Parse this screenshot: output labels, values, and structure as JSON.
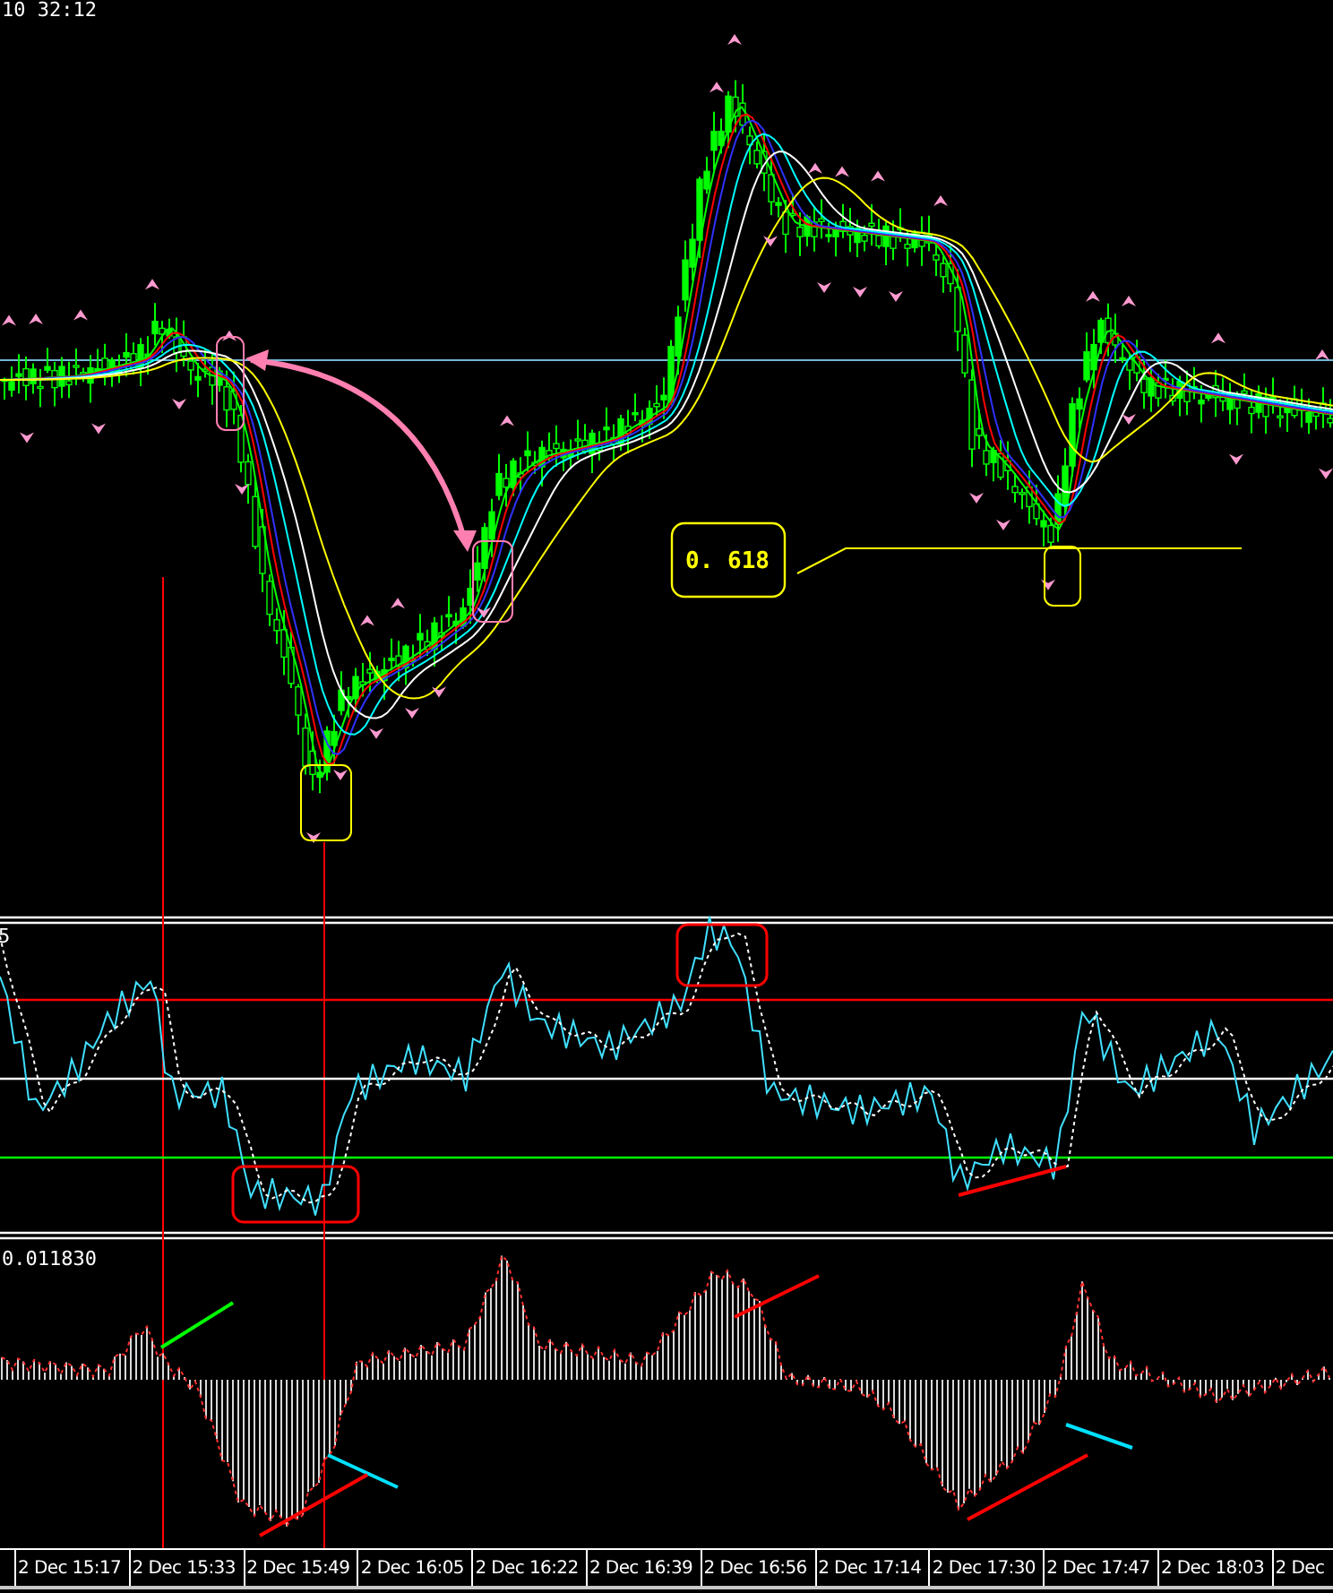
{
  "main_pane": {
    "time_label": "10 32:12",
    "ratio_label": "0. 618"
  },
  "oscillator_pane": {
    "label": "5"
  },
  "histogram_pane": {
    "label": "0.011830"
  },
  "time_axis": {
    "labels": [
      "2 Dec 15:17",
      "2 Dec 15:33",
      "2 Dec 15:49",
      "2 Dec 16:05",
      "2 Dec 16:22",
      "2 Dec 16:39",
      "2 Dec 16:56",
      "2 Dec 17:14",
      "2 Dec 17:30",
      "2 Dec 17:47",
      "2 Dec 18:03",
      "2 Dec"
    ]
  }
}
